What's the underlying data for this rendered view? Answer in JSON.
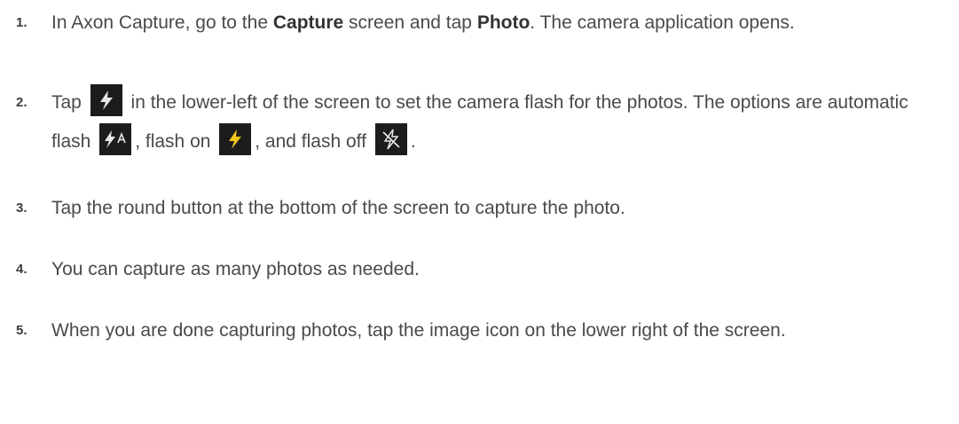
{
  "steps": [
    {
      "number": "1.",
      "before_bold1": "In Axon Capture, go to the ",
      "bold1": "Capture",
      "between": " screen and tap ",
      "bold2": "Photo",
      "after": ". The camera application opens."
    },
    {
      "number": "2.",
      "part1": "Tap ",
      "part2": " in the lower-left of the screen to set the camera flash for the photos. The options are automatic flash ",
      "part3": ", flash on ",
      "part4": ", and flash off ",
      "part5": ".",
      "icons": [
        "flash-icon",
        "flash-auto-icon",
        "flash-on-icon",
        "flash-off-icon"
      ],
      "icon_colors": {
        "white": "#e8e8e8",
        "yellow": "#f5c518",
        "background": "#1c1c1c"
      }
    },
    {
      "number": "3.",
      "text": "Tap the round button at the bottom of the screen to capture the photo."
    },
    {
      "number": "4.",
      "text": "You can capture as many photos as needed."
    },
    {
      "number": "5.",
      "text": "When you are done capturing photos, tap the image icon on the lower right of the screen."
    }
  ]
}
